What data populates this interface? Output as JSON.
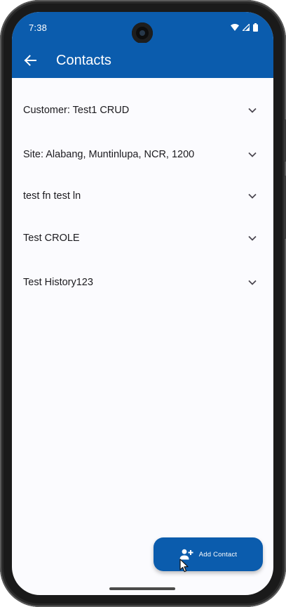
{
  "status_bar": {
    "time": "7:38",
    "icons": [
      "wifi-icon",
      "signal-icon",
      "battery-icon"
    ]
  },
  "app_bar": {
    "back_icon": "arrow-left-icon",
    "title": "Contacts"
  },
  "contacts": [
    {
      "label": "Customer: Test1 CRUD",
      "icon": "chevron-down-icon"
    },
    {
      "label": "Site: Alabang, Muntinlupa, NCR, 1200",
      "icon": "chevron-down-icon"
    },
    {
      "label": "test fn test ln",
      "icon": "chevron-down-icon"
    },
    {
      "label": "Test CROLE",
      "icon": "chevron-down-icon"
    },
    {
      "label": "Test History123",
      "icon": "chevron-down-icon"
    }
  ],
  "fab": {
    "label": "Add Contact",
    "icon": "person-add-icon"
  },
  "colors": {
    "primary": "#0b5cad",
    "background": "#fbfbfe",
    "text": "#1c1b1f"
  }
}
